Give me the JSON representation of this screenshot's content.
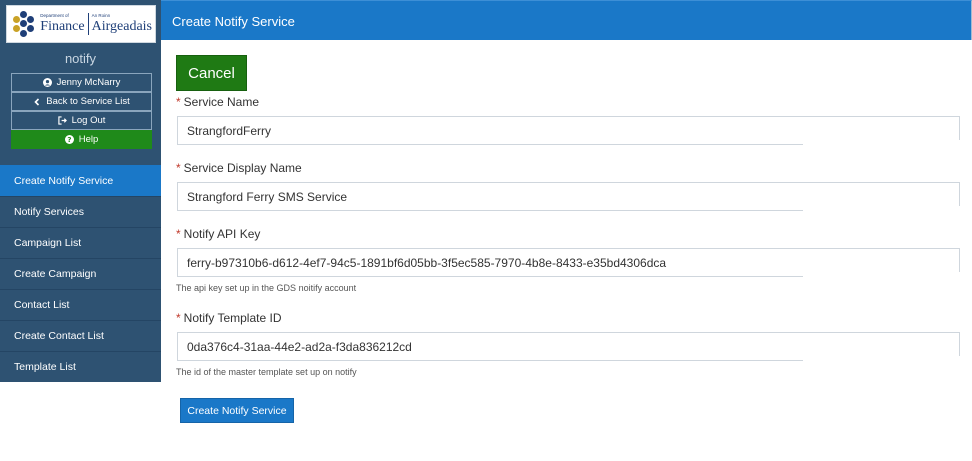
{
  "logo": {
    "left_small": "Department of",
    "left_big": "Finance",
    "right_small": "An Roinn",
    "right_big": "Airgeadais"
  },
  "sidebar": {
    "app_name": "notify",
    "user_button": "Jenny McNarry",
    "back_button": "Back to Service List",
    "logout_button": "Log Out",
    "help_button": "Help",
    "nav": [
      {
        "label": "Create Notify Service"
      },
      {
        "label": "Notify Services"
      },
      {
        "label": "Campaign List"
      },
      {
        "label": "Create Campaign"
      },
      {
        "label": "Contact List"
      },
      {
        "label": "Create Contact List"
      },
      {
        "label": "Template List"
      }
    ]
  },
  "header": {
    "title": "Create Notify Service"
  },
  "form": {
    "cancel_label": "Cancel",
    "required_marker": "*",
    "fields": [
      {
        "label": "Service Name",
        "value": "StrangfordFerry"
      },
      {
        "label": "Service Display Name",
        "value": "Strangford Ferry SMS Service"
      },
      {
        "label": "Notify API Key",
        "value": "ferry-b97310b6-d612-4ef7-94c5-1891bf6d05bb-3f5ec585-7970-4b8e-8433-e35bd4306dca",
        "hint": "The api key set up in the GDS noitify account"
      },
      {
        "label": "Notify Template ID",
        "value": "0da376c4-31aa-44e2-ad2a-f3da836212cd",
        "hint": "The id of the master template set up on notify"
      }
    ],
    "submit_label": "Create Notify Service"
  },
  "colors": {
    "sidebar_bg": "#2e5272",
    "accent_blue": "#1a78c8",
    "cancel_green": "#1f7a14",
    "help_green": "#1f8a1a",
    "required_red": "#c0392b"
  },
  "icons": {
    "user": "user-circle-icon",
    "back": "chevron-left-icon",
    "logout": "sign-out-icon",
    "help": "question-circle-icon"
  }
}
